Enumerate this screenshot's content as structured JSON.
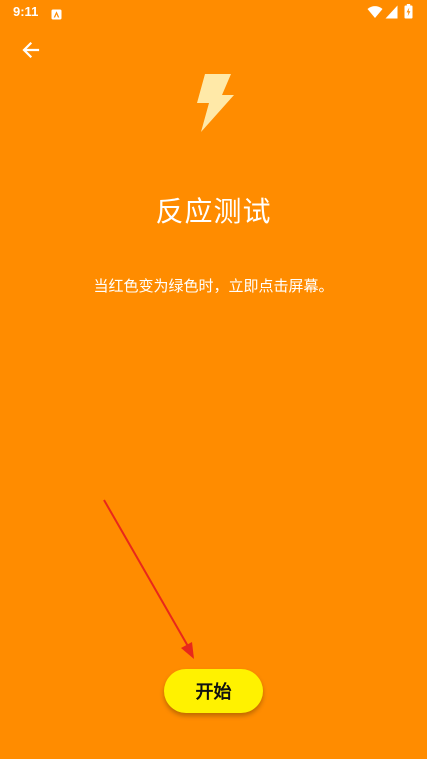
{
  "status_bar": {
    "time": "9:11",
    "icons": [
      "app-notification-icon",
      "wifi-icon",
      "signal-icon",
      "battery-icon"
    ]
  },
  "header": {
    "back_icon": "arrow-left-icon"
  },
  "main": {
    "hero_icon": "lightning-bolt-icon",
    "title": "反应测试",
    "instruction": "当红色变为绿色时，立即点击屏幕。",
    "start_label": "开始"
  },
  "colors": {
    "background": "#FF8C00",
    "button": "#FFF200",
    "bolt": "#FFE9A8",
    "annotation_arrow": "#E8281B"
  }
}
